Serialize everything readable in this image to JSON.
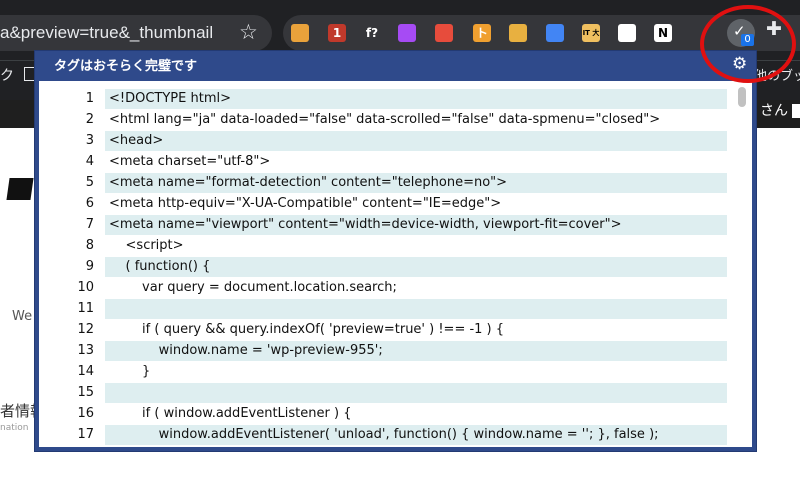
{
  "browser": {
    "url_text": "a&preview=true&_thumbnail",
    "bookmark_left": "ク",
    "bookmark_right": "他のブッ",
    "user_suffix": "さん"
  },
  "extensions": [
    {
      "name": "ext-icon-1",
      "color": "#e9a23b"
    },
    {
      "name": "ext-icon-2",
      "color": "#c0392b",
      "label": "1"
    },
    {
      "name": "ext-icon-3",
      "color": "#35363a",
      "label": "f?"
    },
    {
      "name": "ext-icon-4",
      "color": "#a64bf4"
    },
    {
      "name": "ext-icon-5",
      "color": "#e74c3c"
    },
    {
      "name": "ext-icon-6",
      "color": "#f0a030",
      "label": "ト"
    },
    {
      "name": "ext-icon-7",
      "color": "#e8b040"
    },
    {
      "name": "ext-icon-8",
      "color": "#4285f4"
    },
    {
      "name": "ext-icon-9",
      "color": "#f0c060",
      "label": "IT 大学"
    },
    {
      "name": "ext-icon-10",
      "color": "#ffffff"
    },
    {
      "name": "ext-icon-11",
      "color": "#ffffff",
      "label": "N"
    }
  ],
  "active_extension": {
    "badge": "0"
  },
  "page_behind": {
    "we_text": "We",
    "info_text": "者情報",
    "nation_text": "nation"
  },
  "popup": {
    "title": "タグはおそらく完璧です",
    "code_lines": [
      {
        "num": "1",
        "text": "<!DOCTYPE html>"
      },
      {
        "num": "2",
        "text": "<html lang=\"ja\" data-loaded=\"false\" data-scrolled=\"false\" data-spmenu=\"closed\">"
      },
      {
        "num": "3",
        "text": "<head>"
      },
      {
        "num": "4",
        "text": "<meta charset=\"utf-8\">"
      },
      {
        "num": "5",
        "text": "<meta name=\"format-detection\" content=\"telephone=no\">"
      },
      {
        "num": "6",
        "text": "<meta http-equiv=\"X-UA-Compatible\" content=\"IE=edge\">"
      },
      {
        "num": "7",
        "text": "<meta name=\"viewport\" content=\"width=device-width, viewport-fit=cover\">"
      },
      {
        "num": "8",
        "text": "    <script>"
      },
      {
        "num": "9",
        "text": "    ( function() {"
      },
      {
        "num": "10",
        "text": "        var query = document.location.search;"
      },
      {
        "num": "11",
        "text": ""
      },
      {
        "num": "12",
        "text": "        if ( query && query.indexOf( 'preview=true' ) !== -1 ) {"
      },
      {
        "num": "13",
        "text": "            window.name = 'wp-preview-955';"
      },
      {
        "num": "14",
        "text": "        }"
      },
      {
        "num": "15",
        "text": ""
      },
      {
        "num": "16",
        "text": "        if ( window.addEventListener ) {"
      },
      {
        "num": "17",
        "text": "            window.addEventListener( 'unload', function() { window.name = ''; }, false );"
      }
    ]
  }
}
